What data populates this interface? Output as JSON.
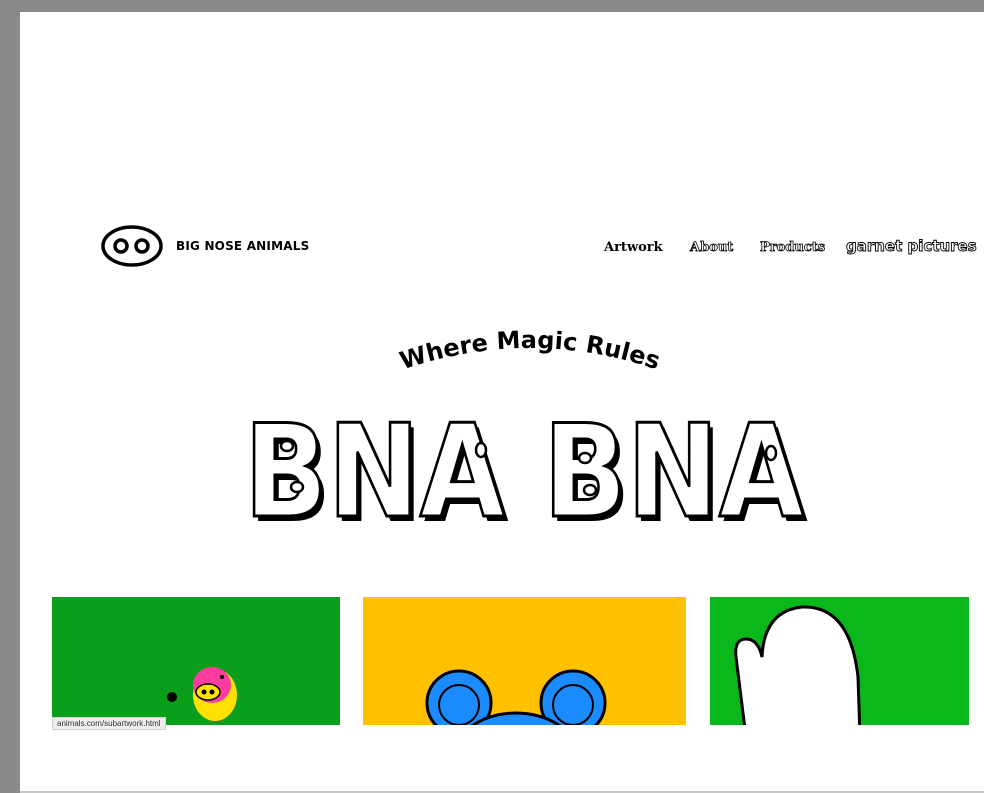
{
  "brand": {
    "name": "BIG NOSE ANIMALS",
    "logo_icon": "nose-logo-icon"
  },
  "nav": {
    "items": [
      {
        "label": "Artwork",
        "active": true
      },
      {
        "label": "About",
        "active": false
      },
      {
        "label": "Products",
        "active": false
      },
      {
        "label": "garnet pictures",
        "active": false
      }
    ]
  },
  "hero": {
    "tagline": "Where Magic Rules",
    "title": "BNA BNA"
  },
  "gallery": {
    "cards": [
      {
        "color": "#0a9e1a",
        "icon": "pink-pig-character-icon"
      },
      {
        "color": "#ffc000",
        "icon": "blue-bear-character-icon"
      },
      {
        "color": "#0ab81c",
        "icon": "white-mitten-character-icon"
      }
    ]
  },
  "status_bar": {
    "url": "animals.com/subartwork.html"
  }
}
